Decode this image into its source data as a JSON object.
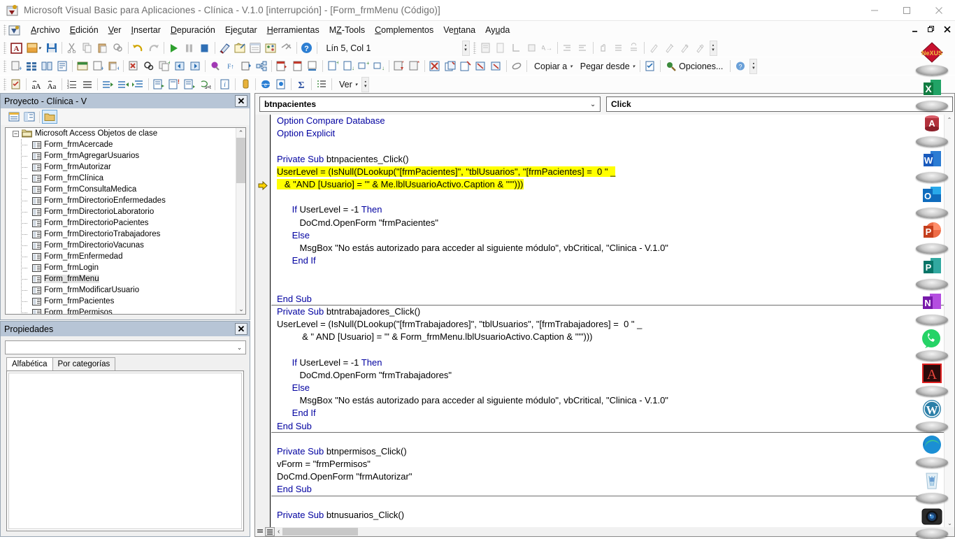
{
  "window": {
    "title": "Microsoft Visual Basic para Aplicaciones - Clínica - V.1.0 [interrupción] - [Form_frmMenu (Código)]",
    "app_icon": "vba-icon",
    "minimize_label": "—",
    "maximize_label": "▢",
    "close_label": "✕"
  },
  "menubar": {
    "items": [
      {
        "label": "Archivo",
        "accel": "A"
      },
      {
        "label": "Edición",
        "accel": "E"
      },
      {
        "label": "Ver",
        "accel": "V"
      },
      {
        "label": "Insertar",
        "accel": "I"
      },
      {
        "label": "Depuración",
        "accel": "D"
      },
      {
        "label": "Ejecutar",
        "accel": "c"
      },
      {
        "label": "Herramientas",
        "accel": "H"
      },
      {
        "label": "MZ-Tools",
        "accel": "Z"
      },
      {
        "label": "Complementos",
        "accel": "C"
      },
      {
        "label": "Ventana",
        "accel": "n"
      },
      {
        "label": "Ayuda",
        "accel": "u"
      }
    ],
    "mdi_restore": "🗗",
    "mdi_minimize": "_",
    "mdi_close": "✕"
  },
  "toolbar_standard": {
    "position_label": "Lín 5, Col 1",
    "buttons": [
      "access-view-icon",
      "save-project-icon",
      "save-icon",
      "cut-icon",
      "copy-icon",
      "paste-icon",
      "find-icon",
      "undo-icon",
      "redo-icon",
      "run-icon",
      "break-icon",
      "reset-icon",
      "design-mode-icon",
      "project-explorer-icon",
      "properties-window-icon",
      "object-browser-icon",
      "toolbox-icon",
      "help-icon"
    ]
  },
  "toolbar_mztools": {
    "buttons": [
      "add-procedure-icon",
      "review-source-icon",
      "code-templates-icon",
      "code-summary-icon",
      "module-header-icon",
      "procedure-header-icon",
      "paste-header-icon",
      "remove-errors-icon",
      "find-advanced-icon",
      "replace-icon",
      "goto-prev-icon",
      "goto-next-icon",
      "color-icon",
      "sort-procedures-icon",
      "split-procedure-icon",
      "flow-icon",
      "insert-block-icon",
      "insert-block2-icon",
      "underline-icon",
      "copy-block-icon",
      "move-block-icon",
      "add-line-icon",
      "remove-line-icon",
      "export-icon",
      "import-icon",
      "delete-module-icon",
      "duplicate-module-icon"
    ]
  },
  "toolbar_edit": {
    "view_label": "Ver",
    "copy_to_label": "Copiar a",
    "paste_from_label": "Pegar desde",
    "options_label": "Opciones...",
    "buttons": [
      "clipboard-icon",
      "uppercase-icon",
      "lowercase-icon",
      "numbered-list-icon",
      "bulleted-list-icon",
      "indent-icon",
      "outdent-icon",
      "align-icon",
      "comment-block-icon",
      "uncomment-block-icon",
      "comment-line-icon",
      "replace-text-icon",
      "info-icon",
      "bookmark-icon",
      "web-icon",
      "doc-icon",
      "sum-icon",
      "list-icon"
    ]
  },
  "project_panel": {
    "title": "Proyecto - Clínica - V",
    "close_label": "✕",
    "toolbar_buttons": [
      "view-code-icon",
      "view-object-icon",
      "toggle-folders-icon"
    ],
    "root": {
      "label": "Microsoft Access Objetos de clase",
      "expanded": true,
      "expander": "−"
    },
    "items": [
      {
        "label": "Form_frmAcercade",
        "selected": false
      },
      {
        "label": "Form_frmAgregarUsuarios",
        "selected": false
      },
      {
        "label": "Form_frmAutorizar",
        "selected": false
      },
      {
        "label": "Form_frmClínica",
        "selected": false
      },
      {
        "label": "Form_frmConsultaMedica",
        "selected": false
      },
      {
        "label": "Form_frmDirectorioEnfermedades",
        "selected": false
      },
      {
        "label": "Form_frmDirectorioLaboratorio",
        "selected": false
      },
      {
        "label": "Form_frmDirectorioPacientes",
        "selected": false
      },
      {
        "label": "Form_frmDirectorioTrabajadores",
        "selected": false
      },
      {
        "label": "Form_frmDirectorioVacunas",
        "selected": false
      },
      {
        "label": "Form_frmEnfermedad",
        "selected": false
      },
      {
        "label": "Form_frmLogin",
        "selected": false
      },
      {
        "label": "Form_frmMenu",
        "selected": true
      },
      {
        "label": "Form_frmModificarUsuario",
        "selected": false
      },
      {
        "label": "Form_frmPacientes",
        "selected": false
      },
      {
        "label": "Form_frmPermisos",
        "selected": false
      }
    ]
  },
  "properties_panel": {
    "title": "Propiedades",
    "close_label": "✕",
    "combo_value": "",
    "tabs": [
      {
        "label": "Alfabética",
        "active": true
      },
      {
        "label": "Por categorías",
        "active": false
      }
    ]
  },
  "code_window": {
    "object_combo": {
      "value": "btnpacientes",
      "arrow": "⌄"
    },
    "procedure_combo": {
      "value": "Click",
      "arrow": "⌄"
    },
    "exec_arrow_line": 5,
    "lines": [
      {
        "n": 1,
        "segs": [
          {
            "t": "Option Compare Database",
            "c": "kw"
          }
        ]
      },
      {
        "n": 2,
        "segs": [
          {
            "t": "Option Explicit",
            "c": "kw"
          }
        ]
      },
      {
        "n": 3,
        "segs": [
          {
            "t": "",
            "c": ""
          }
        ]
      },
      {
        "n": 4,
        "segs": [
          {
            "t": "Private Sub ",
            "c": "kw"
          },
          {
            "t": "btnpacientes_Click()",
            "c": ""
          }
        ]
      },
      {
        "n": 5,
        "segs": [
          {
            "t": "UserLevel = (IsNull(DLookup(\"[frmPacientes]\", \"tblUsuarios\", \"[frmPacientes] =  0 \" _",
            "c": "hl"
          }
        ]
      },
      {
        "n": 6,
        "segs": [
          {
            "t": "   & \"AND [Usuario] = '\" & Me.lblUsuarioActivo.Caption & \"'\")))",
            "c": "hl"
          }
        ]
      },
      {
        "n": 7,
        "segs": [
          {
            "t": "",
            "c": ""
          }
        ]
      },
      {
        "n": 8,
        "segs": [
          {
            "t": "      ",
            "c": ""
          },
          {
            "t": "If ",
            "c": "kw"
          },
          {
            "t": "UserLevel = -1 ",
            "c": ""
          },
          {
            "t": "Then",
            "c": "kw"
          }
        ]
      },
      {
        "n": 9,
        "segs": [
          {
            "t": "         DoCmd.OpenForm \"frmPacientes\"",
            "c": ""
          }
        ]
      },
      {
        "n": 10,
        "segs": [
          {
            "t": "      ",
            "c": ""
          },
          {
            "t": "Else",
            "c": "kw"
          }
        ]
      },
      {
        "n": 11,
        "segs": [
          {
            "t": "         MsgBox \"No estás autorizado para acceder al siguiente módulo\", vbCritical, \"Clinica - V.1.0\"",
            "c": ""
          }
        ]
      },
      {
        "n": 12,
        "segs": [
          {
            "t": "      ",
            "c": ""
          },
          {
            "t": "End If",
            "c": "kw"
          }
        ]
      },
      {
        "n": 13,
        "segs": [
          {
            "t": "",
            "c": ""
          }
        ]
      },
      {
        "n": 14,
        "segs": [
          {
            "t": "",
            "c": ""
          }
        ]
      },
      {
        "n": 15,
        "segs": [
          {
            "t": "End Sub",
            "c": "kw"
          }
        ]
      },
      {
        "n": 16,
        "sep": true,
        "segs": [
          {
            "t": "Private Sub ",
            "c": "kw"
          },
          {
            "t": "btntrabajadores_Click()",
            "c": ""
          }
        ]
      },
      {
        "n": 17,
        "segs": [
          {
            "t": "UserLevel = (IsNull(DLookup(\"[frmTrabajadores]\", \"tblUsuarios\", \"[frmTrabajadores] =  0 \" _",
            "c": ""
          }
        ]
      },
      {
        "n": 18,
        "segs": [
          {
            "t": "          & \" AND [Usuario] = '\" & Form_frmMenu.lblUsuarioActivo.Caption & \"'\")))",
            "c": ""
          }
        ]
      },
      {
        "n": 19,
        "segs": [
          {
            "t": "",
            "c": ""
          }
        ]
      },
      {
        "n": 20,
        "segs": [
          {
            "t": "      ",
            "c": ""
          },
          {
            "t": "If ",
            "c": "kw"
          },
          {
            "t": "UserLevel = -1 ",
            "c": ""
          },
          {
            "t": "Then",
            "c": "kw"
          }
        ]
      },
      {
        "n": 21,
        "segs": [
          {
            "t": "         DoCmd.OpenForm \"frmTrabajadores\"",
            "c": ""
          }
        ]
      },
      {
        "n": 22,
        "segs": [
          {
            "t": "      ",
            "c": ""
          },
          {
            "t": "Else",
            "c": "kw"
          }
        ]
      },
      {
        "n": 23,
        "segs": [
          {
            "t": "         MsgBox \"No estás autorizado para acceder al siguiente módulo\", vbCritical, \"Clinica - V.1.0\"",
            "c": ""
          }
        ]
      },
      {
        "n": 24,
        "segs": [
          {
            "t": "      ",
            "c": ""
          },
          {
            "t": "End If",
            "c": "kw"
          }
        ]
      },
      {
        "n": 25,
        "segs": [
          {
            "t": "End Sub",
            "c": "kw"
          }
        ]
      },
      {
        "n": 26,
        "sep": true,
        "segs": [
          {
            "t": "",
            "c": ""
          }
        ]
      },
      {
        "n": 27,
        "segs": [
          {
            "t": "Private Sub ",
            "c": "kw"
          },
          {
            "t": "btnpermisos_Click()",
            "c": ""
          }
        ]
      },
      {
        "n": 28,
        "segs": [
          {
            "t": "vForm = \"frmPermisos\"",
            "c": ""
          }
        ]
      },
      {
        "n": 29,
        "segs": [
          {
            "t": "DoCmd.OpenForm \"frmAutorizar\"",
            "c": ""
          }
        ]
      },
      {
        "n": 30,
        "segs": [
          {
            "t": "End Sub",
            "c": "kw"
          }
        ]
      },
      {
        "n": 31,
        "sep": true,
        "segs": [
          {
            "t": "",
            "c": ""
          }
        ]
      },
      {
        "n": 32,
        "segs": [
          {
            "t": "Private Sub ",
            "c": "kw"
          },
          {
            "t": "btnusuarios_Click()",
            "c": ""
          }
        ]
      }
    ],
    "scroll_up": "⌃",
    "scroll_down": "⌄",
    "hscroll_left": "‹",
    "view_buttons": [
      "procedure-view-icon",
      "full-module-view-icon"
    ]
  },
  "dock": {
    "items": [
      {
        "name": "nexus-dock-icon",
        "letter": "",
        "color": "#c01020"
      },
      {
        "name": "excel-icon",
        "letter": "X",
        "color": "#1f7244"
      },
      {
        "name": "access-icon",
        "letter": "A",
        "color": "#a4373a"
      },
      {
        "name": "word-icon",
        "letter": "W",
        "color": "#2b579a"
      },
      {
        "name": "outlook-icon",
        "letter": "O",
        "color": "#0f6cbd"
      },
      {
        "name": "powerpoint-icon",
        "letter": "P",
        "color": "#d24726"
      },
      {
        "name": "publisher-icon",
        "letter": "P",
        "color": "#077568"
      },
      {
        "name": "onenote-icon",
        "letter": "N",
        "color": "#7719aa"
      },
      {
        "name": "whatsapp-icon",
        "letter": "",
        "color": "#25d366"
      },
      {
        "name": "adobe-acrobat-icon",
        "letter": "",
        "color": "#b01b13"
      },
      {
        "name": "wordpress-icon",
        "letter": "W",
        "color": "#21759b"
      },
      {
        "name": "microsoft-edge-icon",
        "letter": "",
        "color": "#0d7fd4"
      },
      {
        "name": "recycle-bin-icon",
        "letter": "",
        "color": "#b8d8e8"
      },
      {
        "name": "camera-icon",
        "letter": "",
        "color": "#2a2a2a"
      }
    ]
  },
  "colors": {
    "keyword": "#0000a0",
    "highlight": "#ffff00",
    "panel_title_bg": "#b7c5d6",
    "toolbar_bg": "#fcfcfc"
  }
}
